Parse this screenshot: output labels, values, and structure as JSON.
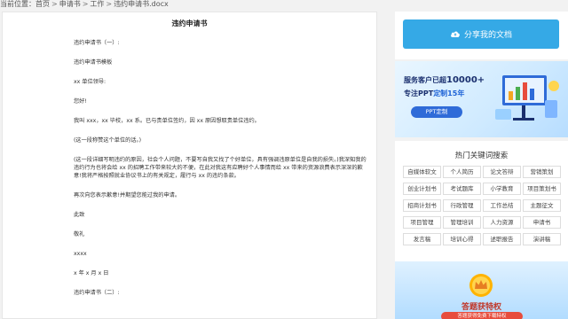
{
  "breadcrumb": {
    "prefix": "当前位置：",
    "items": [
      "首页",
      "申请书",
      "工作",
      "违约申请书.docx"
    ],
    "separator": ">"
  },
  "document": {
    "title": "违约申请书",
    "lines": [
      "违约申请书（一）:",
      "违约申请书模板",
      "xx 单位领导:",
      "您好!",
      "我叫 xxx，xx 毕校，xx 系。已与贵单位签约，因 xx 原因想取贵单位违约。",
      "(这一段称赞这个单位的话。)",
      "(这一段详细写明违约的原因，社会个人问题，不要写自我又找了个好单位，具有强调违原单位是自我的损失。)我深知我的违约行为也将会给 xx 的招聘工作带来较大的不便，在此对我这有应聘好个人事情而给 xx 带来的资源浪费表示深深的歉意!我将严格按照就业协议书上的有关规定，履行与 xx 的违约条款。",
      "再次向您表示歉意!并期望您能过我的申请。",
      "此致",
      "敬礼",
      "xxxx",
      "x 年 x 月 x 日",
      "违约申请书（二）:"
    ]
  },
  "sidebar": {
    "share_label": "分享我的文档",
    "banner1": {
      "line1_prefix": "服务客户已超",
      "line1_number": "10000+",
      "line2_prefix": "专注PPT",
      "line2_accent": "定制15年",
      "button_label": "PPT定制"
    },
    "keywords": {
      "title": "热门关键词搜索",
      "items": [
        "自媒体软文",
        "个人简历",
        "论文答辩",
        "营销策划",
        "创业计划书",
        "考试题库",
        "小学教育",
        "项目策划书",
        "招商计划书",
        "行政管理",
        "工作总结",
        "主题征文",
        "项目管理",
        "管理培训",
        "人力资源",
        "申请书",
        "发言稿",
        "培训心得",
        "述职报告",
        "演讲稿"
      ]
    },
    "banner2": {
      "title": "答题获特权",
      "subtitle": "答题获得免费下载特权"
    }
  },
  "colors": {
    "share_button": "#35a9e6",
    "banner1_button": "#2f6bd8",
    "banner2_accent": "#e74c3c"
  }
}
